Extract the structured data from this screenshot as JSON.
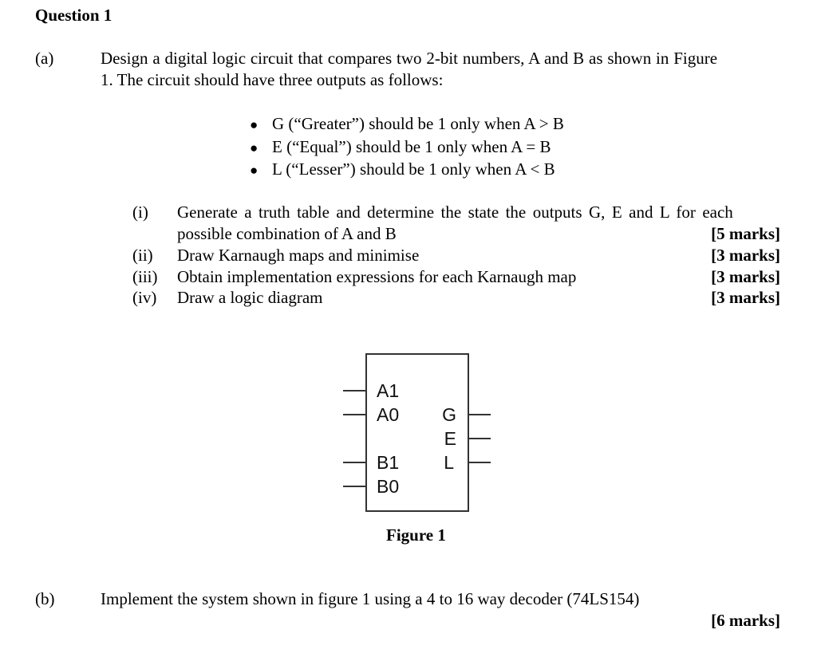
{
  "question_title": "Question 1",
  "part_a": {
    "label": "(a)",
    "intro_line1": "Design a digital logic circuit that compares two 2-bit numbers, A and B as shown in Figure",
    "intro_line2": "1. The circuit should have three outputs as follows:",
    "bullets": [
      "G (“Greater”) should be 1 only when A > B",
      "E (“Equal”) should be 1 only when A = B",
      "L (“Lesser”) should be 1 only when A < B"
    ],
    "subparts": [
      {
        "num": "(i)",
        "line1": "Generate a truth table and determine the state the outputs G, E and L for each",
        "line2": "possible combination of A and B",
        "marks": "[5 marks]"
      },
      {
        "num": "(ii)",
        "text": "Draw Karnaugh maps and minimise",
        "marks": "[3 marks]"
      },
      {
        "num": "(iii)",
        "text": "Obtain implementation expressions for each Karnaugh map",
        "marks": "[3 marks]"
      },
      {
        "num": "(iv)",
        "text": "Draw a logic diagram",
        "marks": "[3 marks]"
      }
    ]
  },
  "figure": {
    "inputs": [
      "A1",
      "A0",
      "B1",
      "B0"
    ],
    "outputs": [
      "G",
      "E",
      "L"
    ],
    "caption": "Figure 1"
  },
  "part_b": {
    "label": "(b)",
    "text": "Implement the system shown in figure 1 using a 4 to 16 way decoder (74LS154)",
    "marks": "[6 marks]"
  }
}
